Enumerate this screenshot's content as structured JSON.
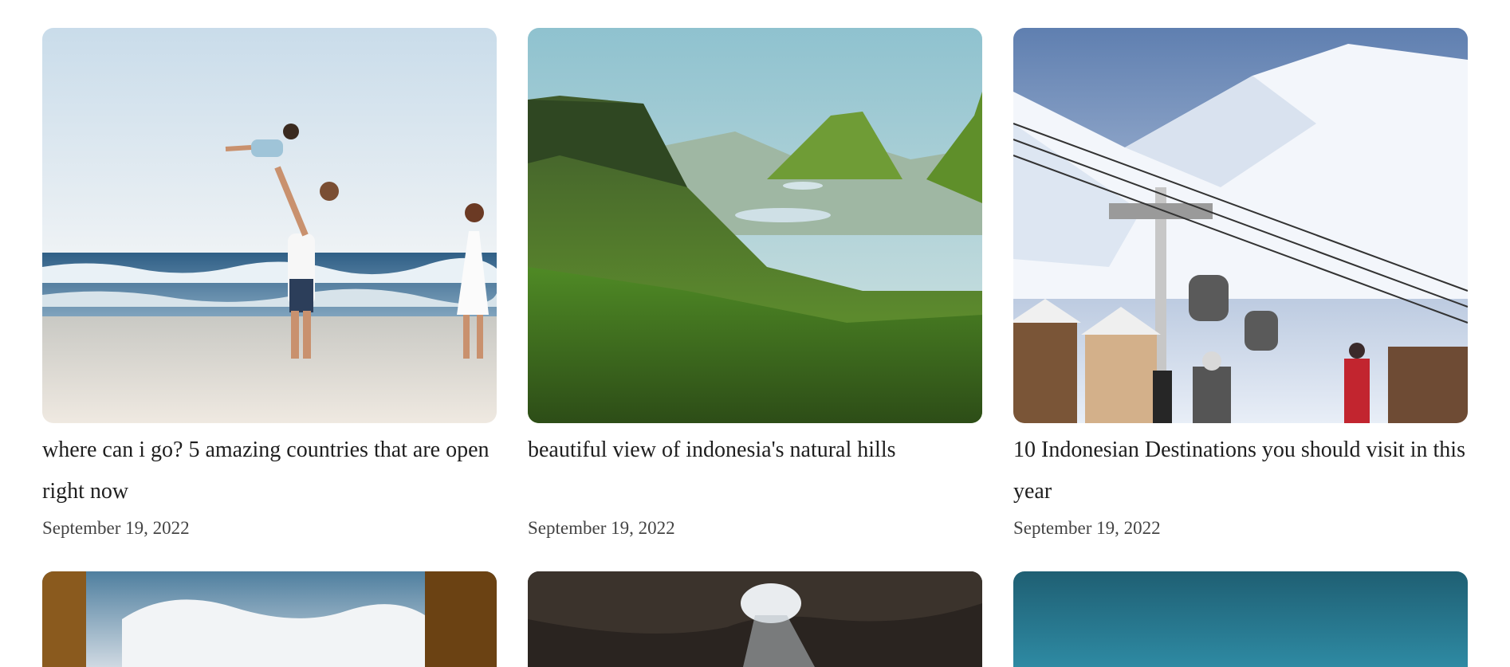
{
  "posts": [
    {
      "image_label": "Family on beach: father lifting child, mother in white dress",
      "title": "where can i go? 5 amazing countries that are open right now",
      "date": "September 19, 2022"
    },
    {
      "image_label": "Green mountain hills with lakes",
      "title": "beautiful view of indonesia's natural hills",
      "date": "September 19, 2022"
    },
    {
      "image_label": "Snowy ski resort with gondola lift and skiers",
      "title": "10 Indonesian Destinations you should visit in this year",
      "date": "September 19, 2022"
    }
  ],
  "colors": {
    "title_text": "#1e1e1e",
    "date_text": "#444444",
    "background": "#ffffff"
  }
}
